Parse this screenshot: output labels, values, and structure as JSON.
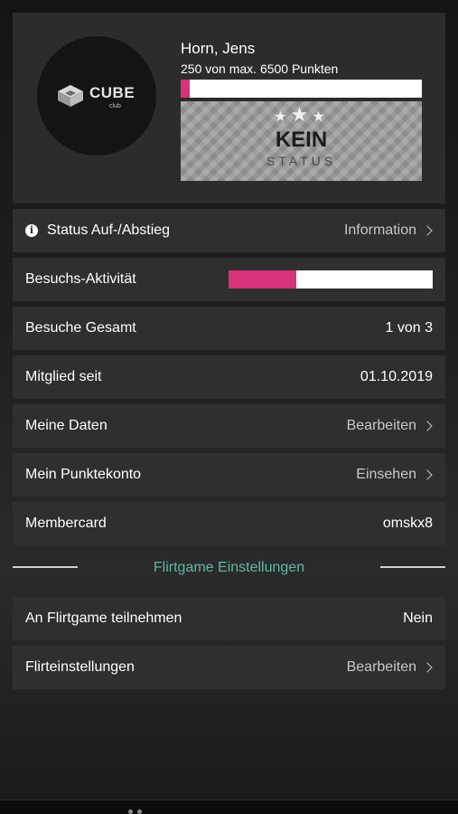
{
  "profile": {
    "logo_word": "CUBE",
    "logo_sub": "club",
    "logo_icon": "cube-logo-icon",
    "name": "Horn, Jens",
    "points_text": "250  von max. 6500 Punkten",
    "points_current": 250,
    "points_max": 6500,
    "status_stars": "★★★",
    "status_title": "KEIN",
    "status_sub": "STATUS"
  },
  "rows": {
    "status": {
      "label": "Status Auf-/Abstieg",
      "value": "Information",
      "icon": "info-icon"
    },
    "activity": {
      "label": "Besuchs-Aktivität",
      "level_fraction": 0.33
    },
    "visits": {
      "label": "Besuche Gesamt",
      "value": "1 von 3"
    },
    "member_since": {
      "label": "Mitglied seit",
      "value": "01.10.2019"
    },
    "my_data": {
      "label": "Meine Daten",
      "value": "Bearbeiten"
    },
    "points_account": {
      "label": "Mein Punktekonto",
      "value": "Einsehen"
    },
    "membercard": {
      "label": "Membercard",
      "value": "omskx8"
    }
  },
  "flirtgame": {
    "section_title": "Flirtgame Einstellungen",
    "participate": {
      "label": "An Flirtgame teilnehmen",
      "value": "Nein"
    },
    "settings": {
      "label": "Flirteinstellungen",
      "value": "Bearbeiten"
    }
  },
  "colors": {
    "accent_pink": "#d6337a",
    "accent_teal": "#5fb8a5",
    "row_background": "#2f2f2f"
  }
}
